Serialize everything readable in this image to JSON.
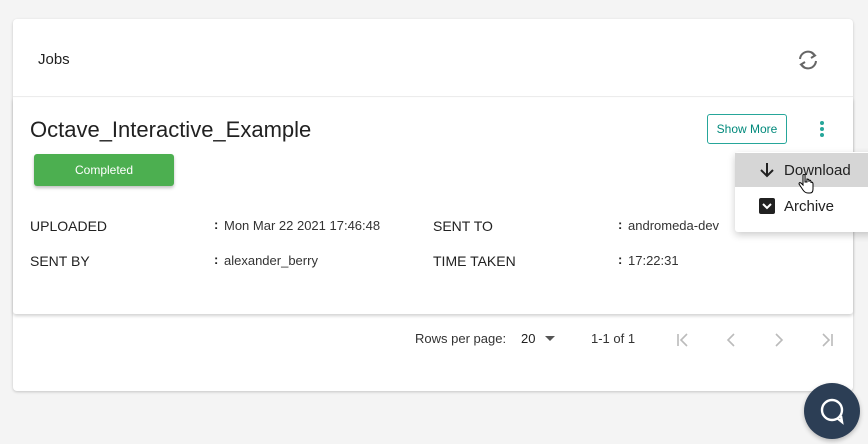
{
  "header": {
    "title": "Jobs",
    "refresh_icon": "refresh-icon"
  },
  "job": {
    "name": "Octave_Interactive_Example",
    "status": "Completed",
    "status_color": "#4caf50",
    "show_more_label": "Show More",
    "fields": {
      "uploaded_label": "UPLOADED",
      "uploaded_value": "Mon Mar 22 2021 17:46:48",
      "sent_to_label": "SENT TO",
      "sent_to_value": "andromeda-dev",
      "sent_by_label": "SENT BY",
      "sent_by_value": "alexander_berry",
      "time_taken_label": "TIME TAKEN",
      "time_taken_value": "17:22:31"
    },
    "separator": ":"
  },
  "menu": {
    "items": [
      {
        "label": "Download",
        "icon": "download-arrow-icon",
        "highlighted": true
      },
      {
        "label": "Archive",
        "icon": "archive-box-icon",
        "highlighted": false
      }
    ]
  },
  "pagination": {
    "rows_per_page_label": "Rows per page:",
    "rows_per_page_value": "20",
    "range_text": "1-1 of 1"
  },
  "colors": {
    "accent": "#26a69a",
    "fab": "#2c3e55"
  }
}
